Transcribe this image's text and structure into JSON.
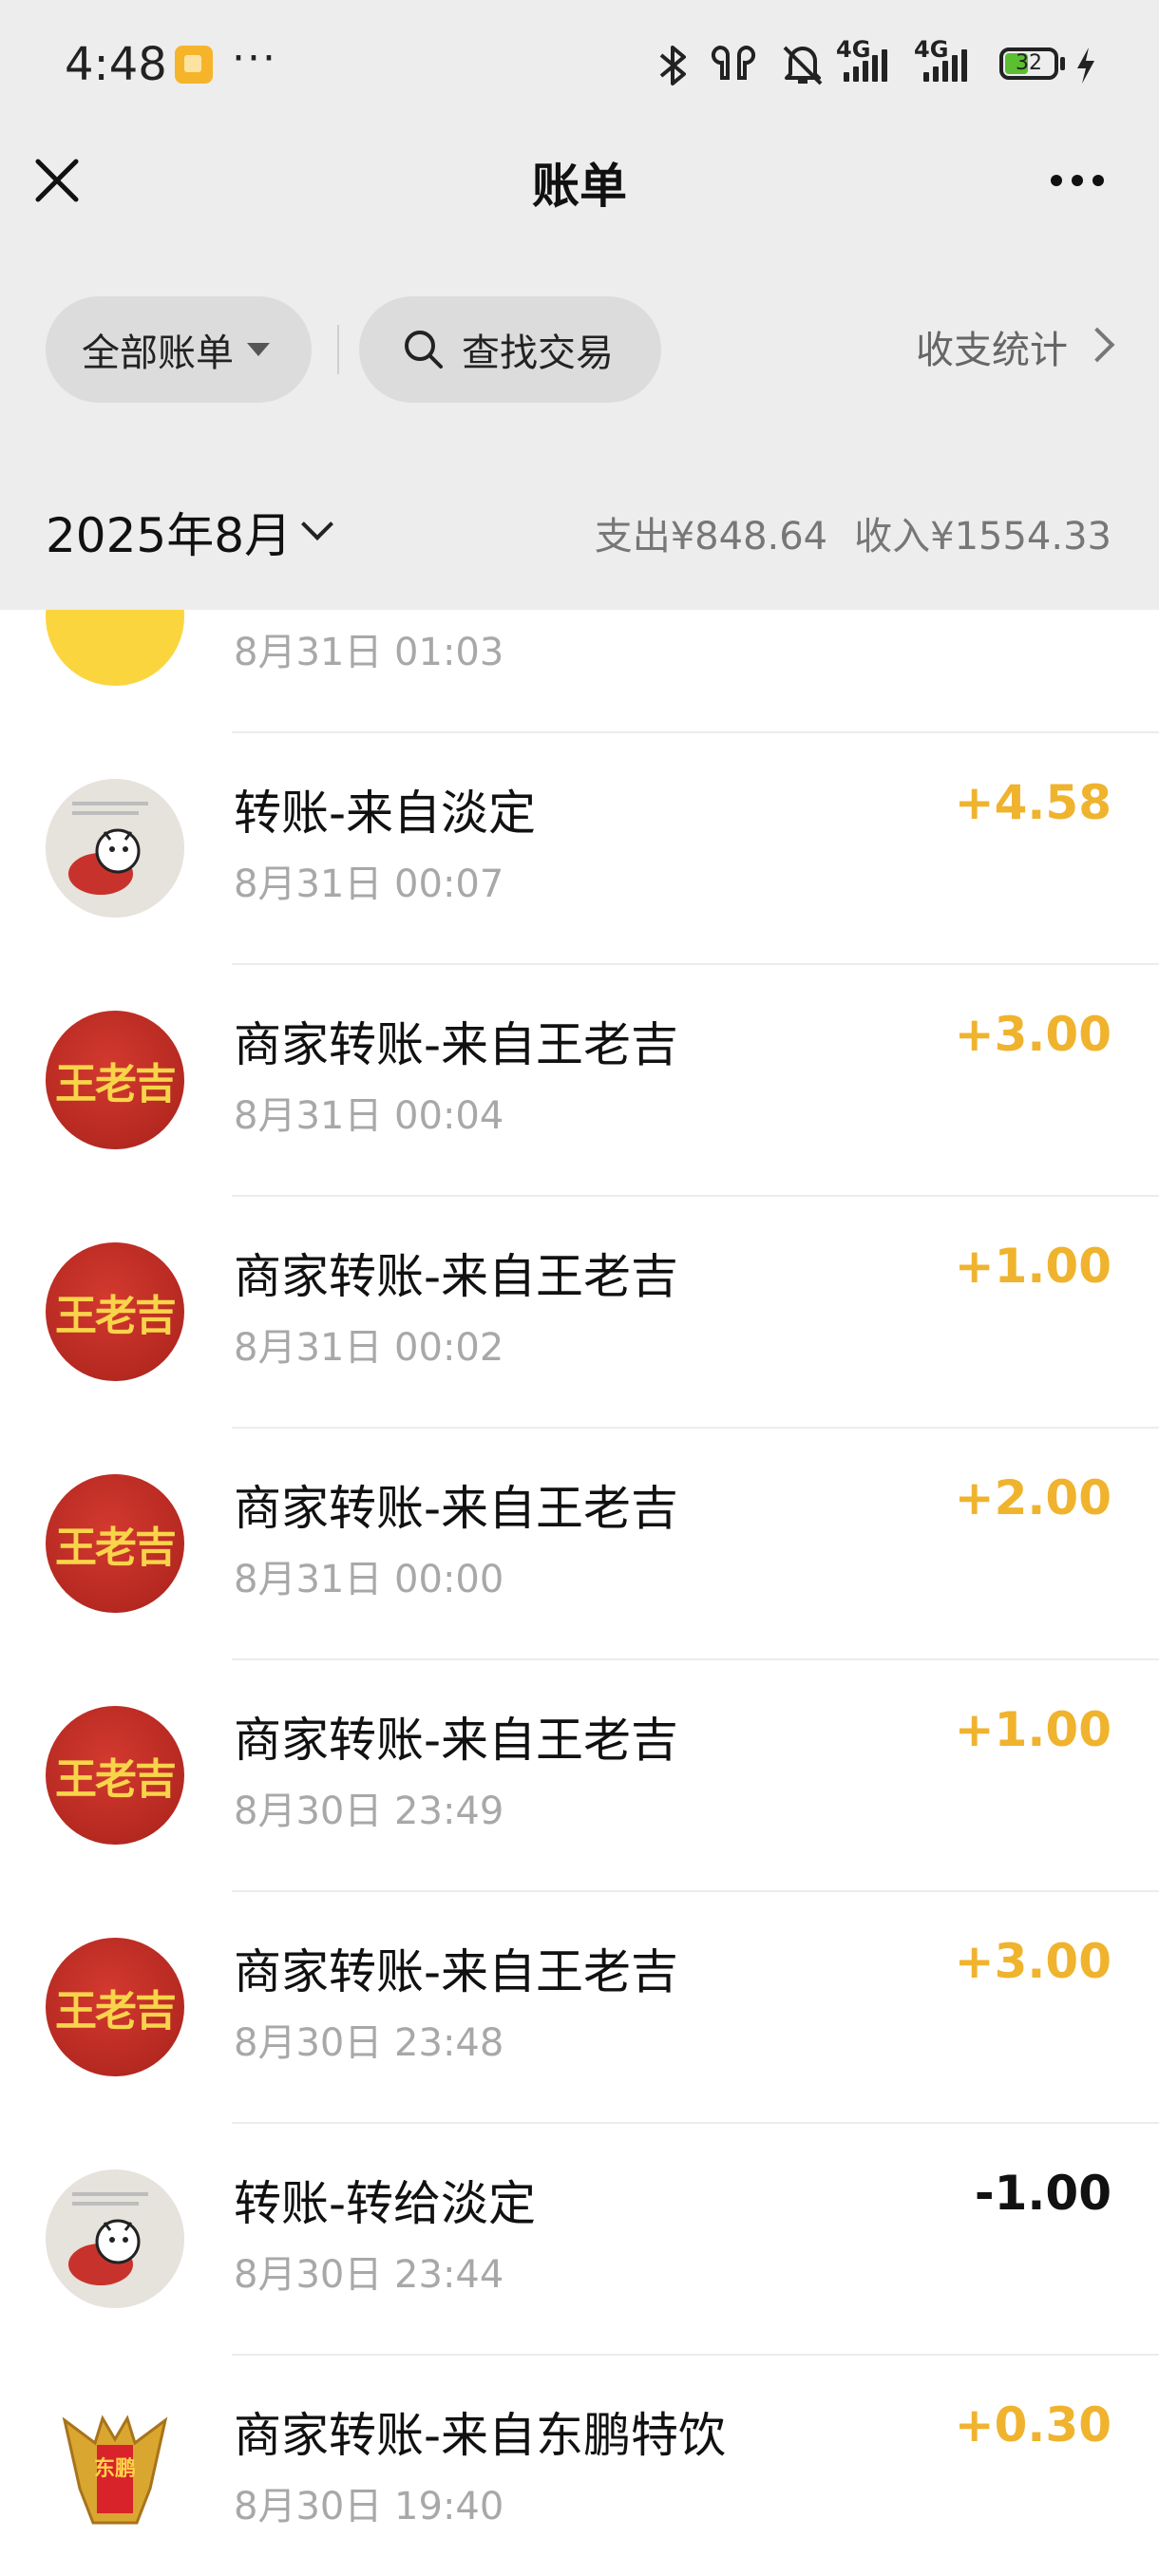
{
  "status_bar": {
    "time": "4:48",
    "dots": "···",
    "network_1": "4G",
    "network_2": "4G",
    "battery": "32"
  },
  "nav": {
    "title": "账单"
  },
  "filters": {
    "all_bills": "全部账单",
    "search": "查找交易",
    "stats": "收支统计"
  },
  "month": {
    "label": "2025年8月",
    "expense": "支出¥848.64",
    "income": "收入¥1554.33"
  },
  "transactions": [
    {
      "title": "",
      "time": "8月31日 01:03",
      "amount": "",
      "avatar": "yellow"
    },
    {
      "title": "转账-来自淡定",
      "time": "8月31日 00:07",
      "amount": "+4.58",
      "avatar": "danding"
    },
    {
      "title": "商家转账-来自王老吉",
      "time": "8月31日 00:04",
      "amount": "+3.00",
      "avatar": "wanglaoji"
    },
    {
      "title": "商家转账-来自王老吉",
      "time": "8月31日 00:02",
      "amount": "+1.00",
      "avatar": "wanglaoji"
    },
    {
      "title": "商家转账-来自王老吉",
      "time": "8月31日 00:00",
      "amount": "+2.00",
      "avatar": "wanglaoji"
    },
    {
      "title": "商家转账-来自王老吉",
      "time": "8月30日 23:49",
      "amount": "+1.00",
      "avatar": "wanglaoji"
    },
    {
      "title": "商家转账-来自王老吉",
      "time": "8月30日 23:48",
      "amount": "+3.00",
      "avatar": "wanglaoji"
    },
    {
      "title": "转账-转给淡定",
      "time": "8月30日 23:44",
      "amount": "-1.00",
      "avatar": "danding"
    },
    {
      "title": "商家转账-来自东鹏特饮",
      "time": "8月30日 19:40",
      "amount": "+0.30",
      "avatar": "dongpeng"
    }
  ],
  "logos": {
    "wanglaoji": "王老吉",
    "dongpeng": "东鹏"
  },
  "colors": {
    "income": "#f0b32e",
    "expense": "#111111",
    "header_bg": "#ededed"
  }
}
